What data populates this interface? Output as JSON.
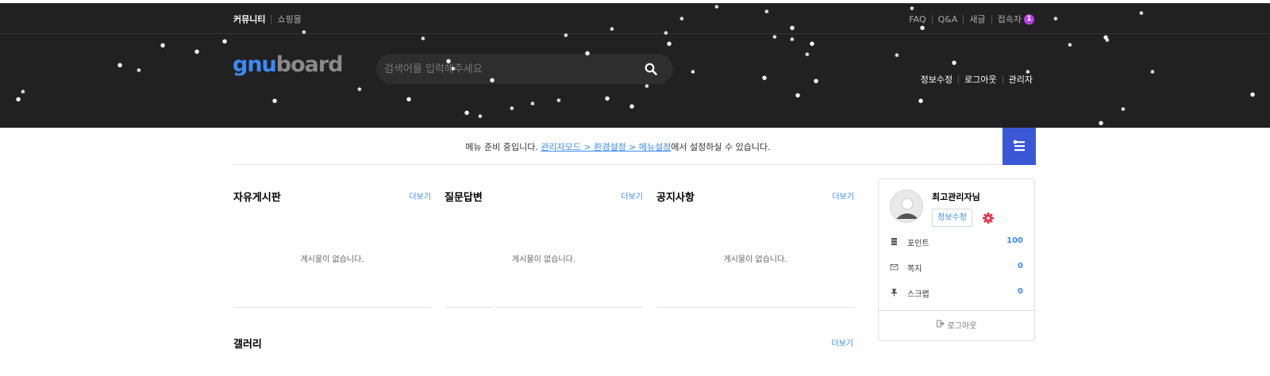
{
  "tnb": {
    "community": "커뮤니티",
    "shopping": "쇼핑몰",
    "faq": "FAQ",
    "qa": "Q&A",
    "new_posts": "새글",
    "visitors": "접속자",
    "visitors_count": "1"
  },
  "header": {
    "logo_part1": "gnu",
    "logo_part2": "board",
    "search_placeholder": "검색어를 입력해주세요",
    "edit_info": "정보수정",
    "logout": "로그아웃",
    "admin": "관리자"
  },
  "gnb": {
    "msg_before": "메뉴 준비 중입니다. ",
    "msg_link": "관리자모드 > 환경설정 > 메뉴설정",
    "msg_after": "에서 설정하실 수 있습니다."
  },
  "boards": [
    {
      "title": "자유게시판",
      "more": "더보기",
      "empty": "게시물이 없습니다."
    },
    {
      "title": "질문답변",
      "more": "더보기",
      "empty": "게시물이 없습니다."
    },
    {
      "title": "공지사항",
      "more": "더보기",
      "empty": "게시물이 없습니다."
    }
  ],
  "gallery": {
    "title": "갤러리",
    "more": "더보기"
  },
  "outlogin": {
    "name": "최고관리자님",
    "edit_button": "정보수정",
    "point_label": "포인트",
    "point_value": "100",
    "memo_label": "쪽지",
    "memo_value": "0",
    "scrap_label": "스크랩",
    "scrap_value": "0",
    "logout": "로그아웃"
  },
  "colors": {
    "header_bg": "#212121",
    "accent": "#3a8afd",
    "menu_button": "#3a57d8",
    "badge": "#b641e5",
    "gear": "#e0354c"
  }
}
